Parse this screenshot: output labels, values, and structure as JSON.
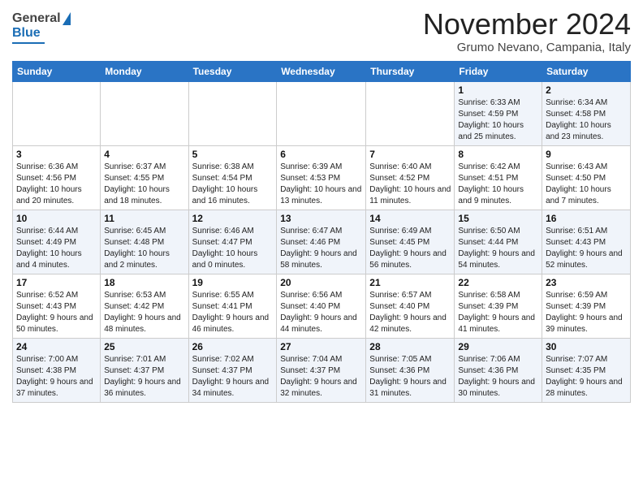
{
  "header": {
    "logo_general": "General",
    "logo_blue": "Blue",
    "month_title": "November 2024",
    "location": "Grumo Nevano, Campania, Italy"
  },
  "weekdays": [
    "Sunday",
    "Monday",
    "Tuesday",
    "Wednesday",
    "Thursday",
    "Friday",
    "Saturday"
  ],
  "weeks": [
    [
      {
        "day": "",
        "info": ""
      },
      {
        "day": "",
        "info": ""
      },
      {
        "day": "",
        "info": ""
      },
      {
        "day": "",
        "info": ""
      },
      {
        "day": "",
        "info": ""
      },
      {
        "day": "1",
        "info": "Sunrise: 6:33 AM\nSunset: 4:59 PM\nDaylight: 10 hours and 25 minutes."
      },
      {
        "day": "2",
        "info": "Sunrise: 6:34 AM\nSunset: 4:58 PM\nDaylight: 10 hours and 23 minutes."
      }
    ],
    [
      {
        "day": "3",
        "info": "Sunrise: 6:36 AM\nSunset: 4:56 PM\nDaylight: 10 hours and 20 minutes."
      },
      {
        "day": "4",
        "info": "Sunrise: 6:37 AM\nSunset: 4:55 PM\nDaylight: 10 hours and 18 minutes."
      },
      {
        "day": "5",
        "info": "Sunrise: 6:38 AM\nSunset: 4:54 PM\nDaylight: 10 hours and 16 minutes."
      },
      {
        "day": "6",
        "info": "Sunrise: 6:39 AM\nSunset: 4:53 PM\nDaylight: 10 hours and 13 minutes."
      },
      {
        "day": "7",
        "info": "Sunrise: 6:40 AM\nSunset: 4:52 PM\nDaylight: 10 hours and 11 minutes."
      },
      {
        "day": "8",
        "info": "Sunrise: 6:42 AM\nSunset: 4:51 PM\nDaylight: 10 hours and 9 minutes."
      },
      {
        "day": "9",
        "info": "Sunrise: 6:43 AM\nSunset: 4:50 PM\nDaylight: 10 hours and 7 minutes."
      }
    ],
    [
      {
        "day": "10",
        "info": "Sunrise: 6:44 AM\nSunset: 4:49 PM\nDaylight: 10 hours and 4 minutes."
      },
      {
        "day": "11",
        "info": "Sunrise: 6:45 AM\nSunset: 4:48 PM\nDaylight: 10 hours and 2 minutes."
      },
      {
        "day": "12",
        "info": "Sunrise: 6:46 AM\nSunset: 4:47 PM\nDaylight: 10 hours and 0 minutes."
      },
      {
        "day": "13",
        "info": "Sunrise: 6:47 AM\nSunset: 4:46 PM\nDaylight: 9 hours and 58 minutes."
      },
      {
        "day": "14",
        "info": "Sunrise: 6:49 AM\nSunset: 4:45 PM\nDaylight: 9 hours and 56 minutes."
      },
      {
        "day": "15",
        "info": "Sunrise: 6:50 AM\nSunset: 4:44 PM\nDaylight: 9 hours and 54 minutes."
      },
      {
        "day": "16",
        "info": "Sunrise: 6:51 AM\nSunset: 4:43 PM\nDaylight: 9 hours and 52 minutes."
      }
    ],
    [
      {
        "day": "17",
        "info": "Sunrise: 6:52 AM\nSunset: 4:43 PM\nDaylight: 9 hours and 50 minutes."
      },
      {
        "day": "18",
        "info": "Sunrise: 6:53 AM\nSunset: 4:42 PM\nDaylight: 9 hours and 48 minutes."
      },
      {
        "day": "19",
        "info": "Sunrise: 6:55 AM\nSunset: 4:41 PM\nDaylight: 9 hours and 46 minutes."
      },
      {
        "day": "20",
        "info": "Sunrise: 6:56 AM\nSunset: 4:40 PM\nDaylight: 9 hours and 44 minutes."
      },
      {
        "day": "21",
        "info": "Sunrise: 6:57 AM\nSunset: 4:40 PM\nDaylight: 9 hours and 42 minutes."
      },
      {
        "day": "22",
        "info": "Sunrise: 6:58 AM\nSunset: 4:39 PM\nDaylight: 9 hours and 41 minutes."
      },
      {
        "day": "23",
        "info": "Sunrise: 6:59 AM\nSunset: 4:39 PM\nDaylight: 9 hours and 39 minutes."
      }
    ],
    [
      {
        "day": "24",
        "info": "Sunrise: 7:00 AM\nSunset: 4:38 PM\nDaylight: 9 hours and 37 minutes."
      },
      {
        "day": "25",
        "info": "Sunrise: 7:01 AM\nSunset: 4:37 PM\nDaylight: 9 hours and 36 minutes."
      },
      {
        "day": "26",
        "info": "Sunrise: 7:02 AM\nSunset: 4:37 PM\nDaylight: 9 hours and 34 minutes."
      },
      {
        "day": "27",
        "info": "Sunrise: 7:04 AM\nSunset: 4:37 PM\nDaylight: 9 hours and 32 minutes."
      },
      {
        "day": "28",
        "info": "Sunrise: 7:05 AM\nSunset: 4:36 PM\nDaylight: 9 hours and 31 minutes."
      },
      {
        "day": "29",
        "info": "Sunrise: 7:06 AM\nSunset: 4:36 PM\nDaylight: 9 hours and 30 minutes."
      },
      {
        "day": "30",
        "info": "Sunrise: 7:07 AM\nSunset: 4:35 PM\nDaylight: 9 hours and 28 minutes."
      }
    ]
  ]
}
